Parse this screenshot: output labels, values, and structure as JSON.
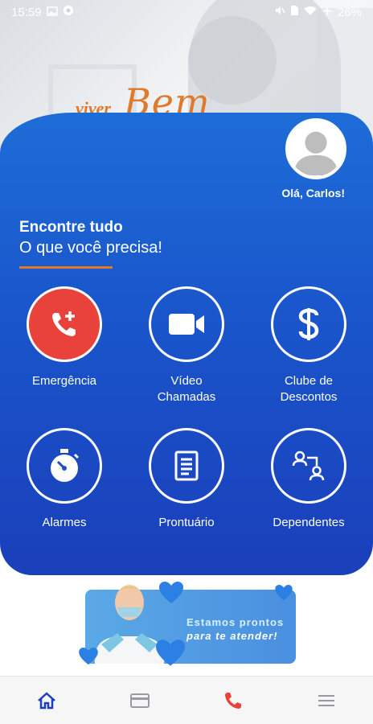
{
  "status_bar": {
    "time": "15:59",
    "battery": "26%",
    "left_icons": [
      "image-icon",
      "circle-badge-icon"
    ],
    "right_icons": [
      "mute-icon",
      "sim-icon",
      "wifi-icon",
      "airplane-icon"
    ]
  },
  "brand": {
    "logo_text_1": "viver",
    "logo_text_2": "Bem",
    "accent_color": "#e07a2a"
  },
  "user": {
    "greeting": "Olá, Carlos!"
  },
  "section": {
    "title": "Encontre tudo",
    "subtitle": "O que você precisa!"
  },
  "services": [
    {
      "label_line1": "Emergência",
      "label_line2": "",
      "icon": "phone-plus-icon"
    },
    {
      "label_line1": "Vídeo",
      "label_line2": "Chamadas",
      "icon": "video-camera-icon"
    },
    {
      "label_line1": "Clube de",
      "label_line2": "Descontos",
      "icon": "dollar-icon"
    },
    {
      "label_line1": "Alarmes",
      "label_line2": "",
      "icon": "stopwatch-icon"
    },
    {
      "label_line1": "Prontuário",
      "label_line2": "",
      "icon": "document-icon"
    },
    {
      "label_line1": "Dependentes",
      "label_line2": "",
      "icon": "dependents-icon"
    }
  ],
  "banner": {
    "line1": "Estamos prontos",
    "line2": "para te atender!"
  },
  "nav": {
    "items": [
      "home-icon",
      "card-icon",
      "phone-icon",
      "menu-icon"
    ],
    "active_color": "#1a3fbb",
    "phone_color": "#e8423a"
  },
  "colors": {
    "panel_top": "#1d6dd8",
    "panel_bottom": "#1a3fbb",
    "emergency": "#e8423a"
  }
}
